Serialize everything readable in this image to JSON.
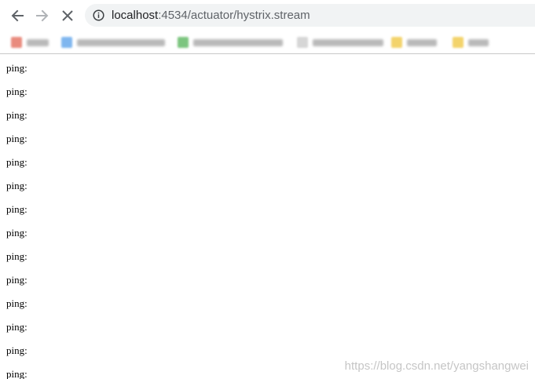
{
  "toolbar": {
    "back_icon": "arrow-left-icon",
    "forward_icon": "arrow-right-icon",
    "stop_icon": "close-icon",
    "info_icon": "info-icon",
    "url_host": "localhost",
    "url_path": ":4534/actuator/hystrix.stream"
  },
  "bookmarks": {
    "items": [
      {
        "favicon_color": "#e98b7e"
      },
      {
        "favicon_color": "#7fb6ef"
      },
      {
        "favicon_color": "#7cc57f"
      },
      {
        "favicon_color": "#d6d6d6"
      },
      {
        "favicon_color": "#f3d36b"
      },
      {
        "favicon_color": "#f3d36b"
      }
    ]
  },
  "content": {
    "lines": [
      "ping:",
      "ping:",
      "ping:",
      "ping:",
      "ping:",
      "ping:",
      "ping:",
      "ping:",
      "ping:",
      "ping:",
      "ping:",
      "ping:",
      "ping:",
      "ping:"
    ]
  },
  "watermark": "https://blog.csdn.net/yangshangwei"
}
